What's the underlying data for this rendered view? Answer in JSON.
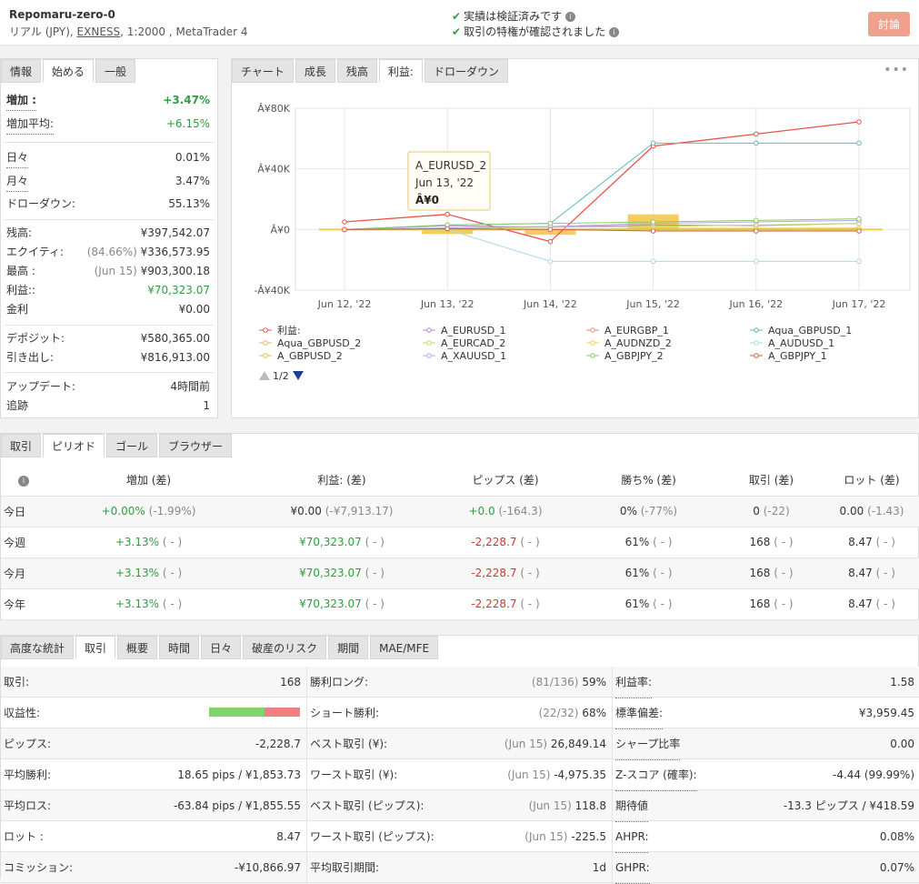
{
  "header": {
    "name": "Repomaru-zero-0",
    "account_type": "リアル (JPY),",
    "broker": "EXNESS",
    "leverage_platform": ", 1:2000 , MetaTrader 4",
    "verified_1": "実績は検証済みです",
    "verified_2": "取引の特権が確認されました",
    "discuss_label": "討論"
  },
  "info_panel": {
    "tabs": [
      "情報",
      "始める",
      "一般"
    ],
    "rows": {
      "gain": {
        "label": "増加 :",
        "value": "+3.47%"
      },
      "avg_gain": {
        "label": "増加平均:",
        "value": "+6.15%"
      },
      "daily": {
        "label": "日々",
        "value": "0.01%"
      },
      "monthly": {
        "label": "月々",
        "value": "3.47%"
      },
      "drawdown": {
        "label": "ドローダウン:",
        "value": "55.13%"
      },
      "balance": {
        "label": "残高:",
        "value": "¥397,542.07"
      },
      "equity": {
        "label": "エクイティ:",
        "note": "(84.66%)",
        "value": "¥336,573.95"
      },
      "highest": {
        "label": "最高 :",
        "note": "(Jun 15)",
        "value": "¥903,300.18"
      },
      "profit": {
        "label": "利益::",
        "value": "¥70,323.07"
      },
      "interest": {
        "label": "金利",
        "value": "¥0.00"
      },
      "deposits": {
        "label": "デポジット:",
        "value": "¥580,365.00"
      },
      "withdrawals": {
        "label": "引き出し:",
        "value": "¥816,913.00"
      },
      "updated": {
        "label": "アップデート:",
        "value": "4時間前"
      },
      "tracking": {
        "label": "追跡",
        "value": "1"
      }
    }
  },
  "chart_panel": {
    "tabs": [
      "チャート",
      "成長",
      "残高",
      "利益:",
      "ドローダウン"
    ],
    "more_label": "•••",
    "pager": "1/2",
    "tooltip": {
      "series": "A_EURUSD_2",
      "date": "Jun 13, '22",
      "value": "Â¥0"
    }
  },
  "chart_data": {
    "type": "line",
    "x": [
      "Jun 12, '22",
      "Jun 13, '22",
      "Jun 14, '22",
      "Jun 15, '22",
      "Jun 16, '22",
      "Jun 17, '22"
    ],
    "y_ticks": [
      "Â¥80K",
      "Â¥40K",
      "Â¥0",
      "-Â¥40K"
    ],
    "ylim": [
      -40000,
      80000
    ],
    "grid": true,
    "legend_position": "bottom",
    "series": [
      {
        "name": "利益:",
        "color": "#e8534a",
        "marker": "circle",
        "values": [
          5000,
          10000,
          -8000,
          55000,
          63000,
          71000
        ]
      },
      {
        "name": "A_EURUSD_1",
        "color": "#b58ad1",
        "marker": "diamond",
        "values": [
          0,
          2500,
          1500,
          3000,
          2500,
          4000
        ]
      },
      {
        "name": "A_EURGBP_1",
        "color": "#e88a7a",
        "marker": "square",
        "values": [
          0,
          500,
          0,
          200,
          100,
          300
        ]
      },
      {
        "name": "Aqua_GBPUSD_1",
        "color": "#5bbcbc",
        "marker": "triangle",
        "values": [
          0,
          3000,
          4000,
          57000,
          57000,
          57000
        ]
      },
      {
        "name": "Aqua_GBPUSD_2",
        "color": "#f2b36a",
        "marker": "triangle-down",
        "values": [
          0,
          0,
          0,
          0,
          0,
          0
        ]
      },
      {
        "name": "A_EURCAD_2",
        "color": "#c5d66a",
        "marker": "circle",
        "values": [
          0,
          800,
          1500,
          2000,
          3000,
          4000
        ]
      },
      {
        "name": "A_AUDNZD_2",
        "color": "#f2d05a",
        "marker": "circle",
        "values": [
          0,
          400,
          300,
          800,
          900,
          1000
        ]
      },
      {
        "name": "A_AUDUSD_1",
        "color": "#a9d7f0",
        "marker": "circle",
        "values": [
          0,
          0,
          -21000,
          -21000,
          -21000,
          -21000
        ]
      },
      {
        "name": "A_GBPUSD_2",
        "color": "#d9c64a",
        "marker": "triangle",
        "values": [
          0,
          0,
          0,
          0,
          0,
          0
        ]
      },
      {
        "name": "A_XAUUSD_1",
        "color": "#b7a6e0",
        "marker": "triangle-down",
        "values": [
          0,
          1000,
          2000,
          4000,
          5000,
          6000
        ]
      },
      {
        "name": "A_GBPJPY_2",
        "color": "#8fc86a",
        "marker": "circle",
        "values": [
          0,
          3000,
          4000,
          5000,
          6000,
          7000
        ]
      },
      {
        "name": "A_GBPJPY_1",
        "color": "#c9624a",
        "marker": "circle",
        "values": [
          0,
          500,
          0,
          -1000,
          -1000,
          -1000
        ]
      }
    ],
    "bars": [
      {
        "x_index": 1,
        "value": -3000
      },
      {
        "x_index": 2,
        "value": -3500
      },
      {
        "x_index": 3,
        "value": 10000
      }
    ]
  },
  "period_panel": {
    "tabs": [
      "取引",
      "ピリオド",
      "ゴール",
      "ブラウザー"
    ],
    "headers": [
      "",
      "増加 (差)",
      "利益: (差)",
      "ピップス (差)",
      "勝ち% (差)",
      "取引 (差)",
      "ロット (差)"
    ],
    "rows": [
      {
        "label": "今日",
        "gain": "+0.00%",
        "gain_d": "(-1.99%)",
        "profit": "¥0.00",
        "profit_d": "(-¥7,913.17)",
        "pips": "+0.0",
        "pips_d": "(-164.3)",
        "win": "0%",
        "win_d": "(-77%)",
        "trades": "0",
        "trades_d": "(-22)",
        "lots": "0.00",
        "lots_d": "(-1.43)",
        "profit_class": "normal",
        "pips_class": "green"
      },
      {
        "label": "今週",
        "gain": "+3.13%",
        "gain_d": "( - )",
        "profit": "¥70,323.07",
        "profit_d": "( - )",
        "pips": "-2,228.7",
        "pips_d": "( - )",
        "win": "61%",
        "win_d": "( - )",
        "trades": "168",
        "trades_d": "( - )",
        "lots": "8.47",
        "lots_d": "( - )",
        "profit_class": "green",
        "pips_class": "red"
      },
      {
        "label": "今月",
        "gain": "+3.13%",
        "gain_d": "( - )",
        "profit": "¥70,323.07",
        "profit_d": "( - )",
        "pips": "-2,228.7",
        "pips_d": "( - )",
        "win": "61%",
        "win_d": "( - )",
        "trades": "168",
        "trades_d": "( - )",
        "lots": "8.47",
        "lots_d": "( - )",
        "profit_class": "green",
        "pips_class": "red"
      },
      {
        "label": "今年",
        "gain": "+3.13%",
        "gain_d": "( - )",
        "profit": "¥70,323.07",
        "profit_d": "( - )",
        "pips": "-2,228.7",
        "pips_d": "( - )",
        "win": "61%",
        "win_d": "( - )",
        "trades": "168",
        "trades_d": "( - )",
        "lots": "8.47",
        "lots_d": "( - )",
        "profit_class": "green",
        "pips_class": "red"
      }
    ]
  },
  "stats_panel": {
    "tabs": [
      "高度な統計",
      "取引",
      "概要",
      "時間",
      "日々",
      "破産のリスク",
      "期間",
      "MAE/MFE"
    ],
    "col1": [
      {
        "label": "取引:",
        "value": "168"
      },
      {
        "label": "収益性:",
        "value": "",
        "bar_win_fraction": 0.61
      },
      {
        "label": "ピップス:",
        "value": "-2,228.7"
      },
      {
        "label": "平均勝利:",
        "value": "18.65 pips / ¥1,853.73"
      },
      {
        "label": "平均ロス:",
        "value": "-63.84 pips / ¥1,855.55"
      },
      {
        "label": "ロット :",
        "value": "8.47"
      },
      {
        "label": "コミッション:",
        "value": "-¥10,866.97"
      }
    ],
    "col2": [
      {
        "label": "勝利ロング:",
        "note": "(81/136)",
        "value": "59%"
      },
      {
        "label": "ショート勝利:",
        "note": "(22/32)",
        "value": "68%"
      },
      {
        "label": "ベスト取引 (¥):",
        "note": "(Jun 15)",
        "value": "26,849.14"
      },
      {
        "label": "ワースト取引 (¥):",
        "note": "(Jun 15)",
        "value": "-4,975.35"
      },
      {
        "label": "ベスト取引 (ピップス):",
        "note": "(Jun 15)",
        "value": "118.8"
      },
      {
        "label": "ワースト取引 (ピップス):",
        "note": "(Jun 15)",
        "value": "-225.5"
      },
      {
        "label": "平均取引期間:",
        "note": "",
        "value": "1d"
      }
    ],
    "col3": [
      {
        "label": "利益率:",
        "value": "1.58"
      },
      {
        "label": "標準偏差:",
        "value": "¥3,959.45"
      },
      {
        "label": "シャープ比率",
        "value": "0.00"
      },
      {
        "label": "Z-スコア (確率):",
        "value": "-4.44 (99.99%)"
      },
      {
        "label": "期待値",
        "value": "-13.3 ピップス / ¥418.59"
      },
      {
        "label": "AHPR:",
        "value": "0.08%"
      },
      {
        "label": "GHPR:",
        "value": "0.07%"
      }
    ]
  }
}
